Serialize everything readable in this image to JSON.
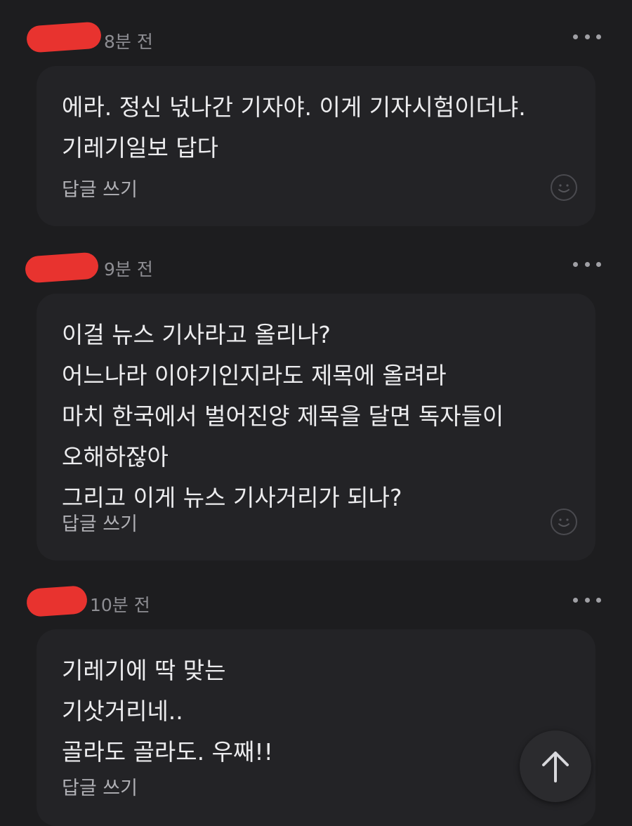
{
  "comments": [
    {
      "time": "8분 전",
      "text": "에라. 정신 넋나간 기자야. 이게 기자시험이더냐.\n기레기일보 답다",
      "reply_label": "답글 쓰기",
      "more_icon": "more-horizontal-icon",
      "emoji_icon": "smile-icon"
    },
    {
      "time": "9분 전",
      "text": "이걸 뉴스 기사라고 올리나?\n어느나라 이야기인지라도 제목에 올려라\n마치 한국에서 벌어진양 제목을 달면 독자들이\n오해하잖아\n그리고 이게 뉴스 기사거리가 되나?",
      "reply_label": "답글 쓰기",
      "more_icon": "more-horizontal-icon",
      "emoji_icon": "smile-icon"
    },
    {
      "time": "10분 전",
      "text": "기레기에 딱 맞는\n기삿거리네..\n골라도 골라도. 우째!!",
      "reply_label": "답글 쓰기",
      "more_icon": "more-horizontal-icon",
      "emoji_icon": "smile-icon"
    }
  ],
  "scroll_top": {
    "icon": "arrow-up-icon"
  },
  "colors": {
    "background": "#1d1d1f",
    "bubble": "#232326",
    "redaction": "#e8332f",
    "text": "#ececee",
    "muted": "#8e8e93"
  }
}
